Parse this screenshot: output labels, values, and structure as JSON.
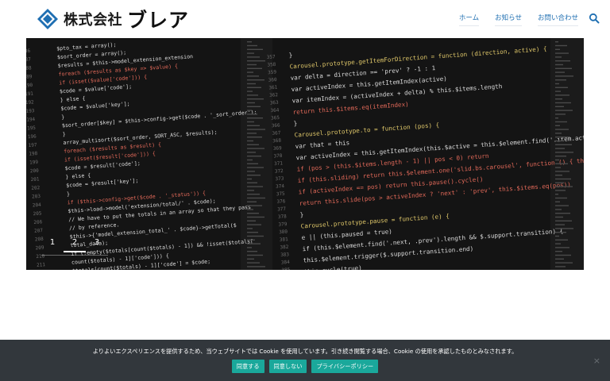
{
  "header": {
    "logo_corp": "株式会社",
    "logo_name": "ブレア",
    "nav": [
      {
        "label": "ホーム"
      },
      {
        "label": "お知らせ"
      },
      {
        "label": "お問い合わせ"
      }
    ],
    "search_icon": "search-icon"
  },
  "hero": {
    "slides": [
      "1",
      "2",
      "3"
    ],
    "active_slide": 2,
    "code_left": [
      "$pto_tax = array();",
      "$sort_order = array();",
      "$results = $this->model_extension_extension",
      "foreach ($results as $key => $value) {",
      "  if (isset($value['code'])) {",
      "    $code = $value['code'];",
      "  } else {",
      "    $code = $value['key'];",
      "  }",
      "  $sort_order[$key] = $this->config->get($code . '_sort_order');",
      "}",
      "array_multisort($sort_order, SORT_ASC, $results);",
      "foreach ($results as $result) {",
      "  if (isset($result['code'])) {",
      "    $code = $result['code'];",
      "  } else {",
      "    $code = $result['key'];",
      "  }",
      "  if ($this->config->get($code . '_status')) {",
      "    $this->load->model('extension/total/' . $code);",
      "    // We have to put the totals in an array so that they pass",
      "    // by reference.",
      "    $this->{'model_extension_total_' . $code}->getTotal($",
      "      total_data);",
      "    if (!empty($totals[count($totals) - 1]) && !isset($totals[",
      "      count($totals) - 1]['code'])) {",
      "      $totals[count($totals) - 1]['code'] = $code;"
    ],
    "code_right": [
      "}",
      "Carousel.prototype.getItemForDirection = function (direction, active) {",
      "  var delta = direction == 'prev' ? -1 : 1",
      "  var activeIndex = this.getItemIndex(active)",
      "  var itemIndex = (activeIndex + delta) % this.$items.length",
      "  return this.$items.eq(itemIndex)",
      "}",
      "Carousel.prototype.to = function (pos) {",
      "  var that = this",
      "  var activeIndex = this.getItemIndex(this.$active = this.$element.find('.item.active'))",
      "  if (pos > (this.$items.length - 1) || pos < 0) return",
      "  if (this.sliding)      return this.$element.one('slid.bs.carousel', function () { that.to(pos) })",
      "  if (activeIndex == pos) return this.pause().cycle()",
      "  return this.slide(pos > activeIndex ? 'next' : 'prev', this.$items.eq(pos))",
      "}",
      "Carousel.prototype.pause = function (e) {",
      "  e || (this.paused = true)",
      "  if (this.$element.find('.next, .prev').length && $.support.transition) {",
      "    this.$element.trigger($.support.transition.end)",
      "    this.cycle(true)"
    ],
    "line_numbers_left": [
      "186",
      "187",
      "188",
      "189",
      "190",
      "191",
      "192",
      "193",
      "194",
      "195",
      "196",
      "197",
      "198",
      "199",
      "200",
      "201",
      "202",
      "203",
      "204",
      "205",
      "206",
      "207",
      "208",
      "209",
      "210",
      "211",
      "212"
    ],
    "line_numbers_right": [
      "357",
      "358",
      "359",
      "360",
      "361",
      "362",
      "363",
      "364",
      "365",
      "366",
      "367",
      "368",
      "369",
      "370",
      "371",
      "372",
      "373",
      "374",
      "375",
      "376",
      "377",
      "378",
      "379",
      "380",
      "381",
      "382",
      "383",
      "384",
      "385",
      "386",
      "387",
      "388"
    ]
  },
  "cookie": {
    "message": "よりよいエクスペリエンスを提供するため、当ウェブサイトでは Cookie を使用しています。引き続き閲覧する場合、Cookie の使用を承認したものとみなされます。",
    "buttons": [
      {
        "label": "同意する"
      },
      {
        "label": "同意しない"
      },
      {
        "label": "プライバシーポリシー"
      }
    ],
    "close_label": "×"
  },
  "colors": {
    "nav_link": "#1f6fb2",
    "logo_blue": "#1f6fb2",
    "cookie_bg": "#32373c",
    "cookie_button": "#1aa89b",
    "hero_bg": "#141414"
  }
}
